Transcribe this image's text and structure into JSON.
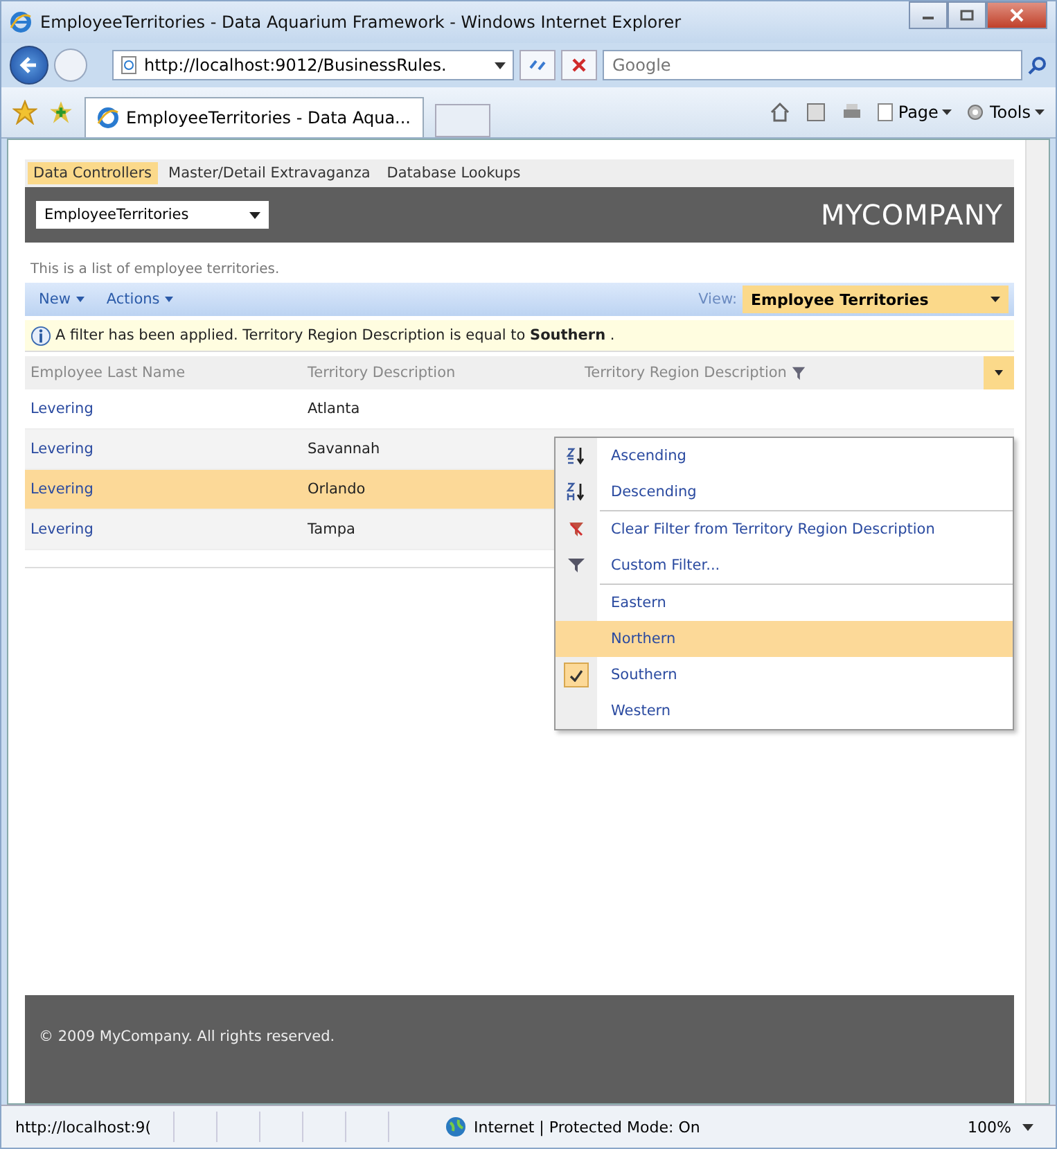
{
  "window": {
    "title": "EmployeeTerritories - Data Aquarium Framework - Windows Internet Explorer"
  },
  "address": {
    "value": "http://localhost:9012/BusinessRules."
  },
  "search": {
    "placeholder": "Google"
  },
  "browser_tab": {
    "label": "EmployeeTerritories - Data Aqua..."
  },
  "command_bar": [
    "Page",
    "Tools"
  ],
  "site_menu": [
    {
      "label": "Data Controllers",
      "selected": true
    },
    {
      "label": "Master/Detail Extravaganza",
      "selected": false
    },
    {
      "label": "Database Lookups",
      "selected": false
    }
  ],
  "controller_select": {
    "value": "EmployeeTerritories"
  },
  "brand": "MYCOMPANY",
  "description": "This is a list of employee territories.",
  "toolbar": {
    "actions": [
      "New",
      "Actions"
    ],
    "view_label": "View:",
    "view_value": "Employee Territories"
  },
  "filter_message": "A filter has been applied. Territory Region Description is equal to **Southern** .",
  "table": {
    "columns": [
      "Employee Last Name",
      "Territory Description",
      "Territory Region Description"
    ],
    "rows": [
      {
        "cells": [
          "Levering",
          "Atlanta"
        ],
        "selected": false
      },
      {
        "cells": [
          "Levering",
          "Savannah"
        ],
        "selected": false
      },
      {
        "cells": [
          "Levering",
          "Orlando"
        ],
        "selected": true
      },
      {
        "cells": [
          "Levering",
          "Tampa"
        ],
        "selected": false
      }
    ]
  },
  "menu": {
    "groups": [
      [
        {
          "kind": "sort-asc",
          "label": "Ascending"
        },
        {
          "kind": "sort-desc",
          "label": "Descending"
        }
      ],
      [
        {
          "kind": "clear-filter",
          "label": "Clear Filter from Territory Region Description"
        },
        {
          "kind": "custom-filter",
          "label": "Custom Filter..."
        }
      ],
      [
        {
          "kind": "value",
          "label": "Eastern",
          "checked": false,
          "selected": false
        },
        {
          "kind": "value",
          "label": "Northern",
          "checked": false,
          "selected": true
        },
        {
          "kind": "value",
          "label": "Southern",
          "checked": true,
          "selected": false
        },
        {
          "kind": "value",
          "label": "Western",
          "checked": false,
          "selected": false
        }
      ]
    ]
  },
  "footer": "© 2009 MyCompany. All rights reserved.",
  "status_bar": {
    "url": "http://localhost:9(",
    "zone": "Internet | Protected Mode: On",
    "zoom": "100%"
  }
}
